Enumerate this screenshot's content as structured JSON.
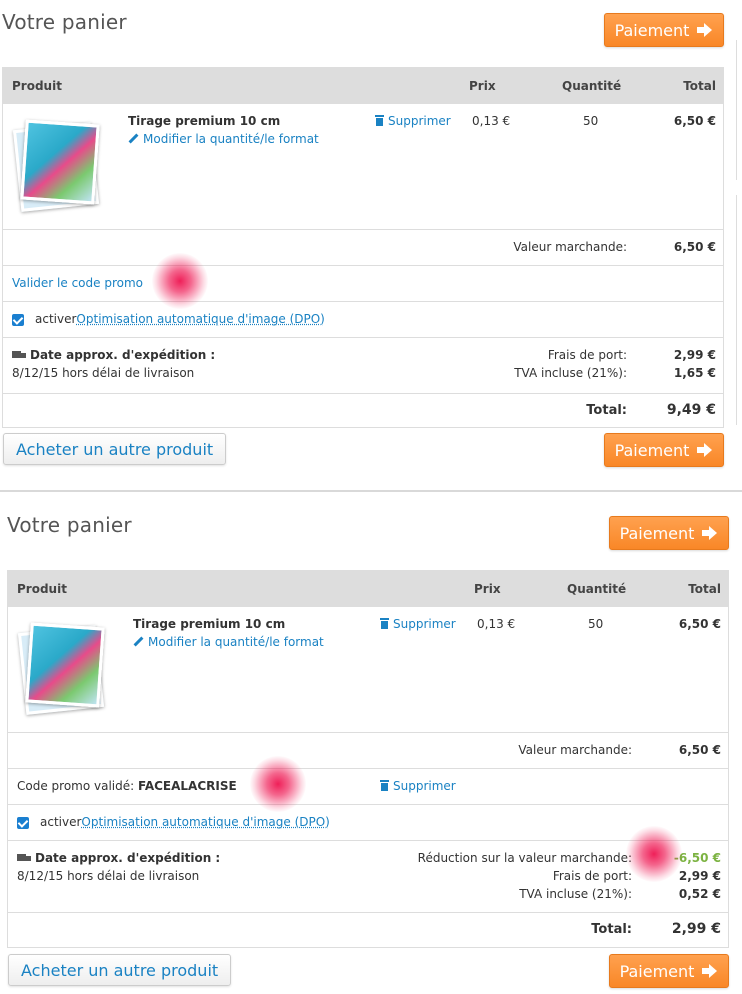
{
  "colors": {
    "accent": "#1a82c3",
    "pay_button": "#f98727",
    "discount": "#7cb342",
    "highlight_marker": "#ee1450"
  },
  "panel_a": {
    "title": "Votre panier",
    "pay_label": "Paiement",
    "headers": {
      "product": "Produit",
      "price": "Prix",
      "quantity": "Quantité",
      "total": "Total"
    },
    "item": {
      "name": "Tirage premium 10 cm",
      "modify": "Modifier la quantité/le format",
      "remove": "Supprimer",
      "price": "0,13 €",
      "quantity": "50",
      "total": "6,50 €"
    },
    "merch_label": "Valeur marchande:",
    "merch_value": "6,50 €",
    "promo_link": "Valider le code promo",
    "dpo_prefix": "activer",
    "dpo_link": "Optimisation automatique d'image (DPO)",
    "shipping_title": "Date approx. d'expédition :",
    "shipping_date": "8/12/15 hors délai de livraison",
    "port_label": "Frais de port:",
    "port_value": "2,99 €",
    "tva_label": "TVA incluse (21%):",
    "tva_value": "1,65 €",
    "total_label": "Total:",
    "total_value": "9,49 €",
    "buy_other": "Acheter un autre produit"
  },
  "panel_b": {
    "title": "Votre panier",
    "pay_label": "Paiement",
    "headers": {
      "product": "Produit",
      "price": "Prix",
      "quantity": "Quantité",
      "total": "Total"
    },
    "item": {
      "name": "Tirage premium 10 cm",
      "modify": "Modifier la quantité/le format",
      "remove": "Supprimer",
      "price": "0,13 €",
      "quantity": "50",
      "total": "6,50 €"
    },
    "merch_label": "Valeur marchande:",
    "merch_value": "6,50 €",
    "promo_label": "Code promo validé:",
    "promo_code": "FACEALACRISE",
    "promo_remove": "Supprimer",
    "dpo_prefix": "activer",
    "dpo_link": "Optimisation automatique d'image (DPO)",
    "shipping_title": "Date approx. d'expédition :",
    "shipping_date": "8/12/15 hors délai de livraison",
    "discount_label": "Réduction sur la valeur marchande:",
    "discount_value": "-6,50 €",
    "port_label": "Frais de port:",
    "port_value": "2,99 €",
    "tva_label": "TVA incluse (21%):",
    "tva_value": "0,52 €",
    "total_label": "Total:",
    "total_value": "2,99 €",
    "buy_other": "Acheter un autre produit"
  }
}
